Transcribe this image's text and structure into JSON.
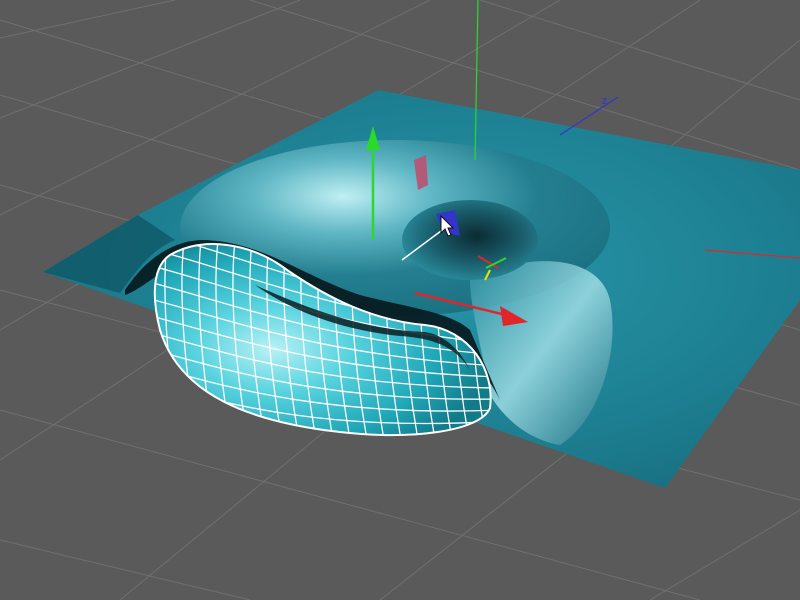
{
  "viewport": {
    "background": "#5a5a5a",
    "grid_color": "#707070",
    "grid_visible": true
  },
  "scene": {
    "plane_color": "#1d8092",
    "plane_shadow_color": "#0d4c59",
    "torus_color": "#28b4c4",
    "torus_highlight": "#a9edf2",
    "wireframe_color": "#ffffff"
  },
  "axes": {
    "x_color": "#e0262a",
    "y_color": "#2bd92b",
    "z_color": "#3335c8"
  },
  "cursor": {
    "icon": "arrow-cursor-icon"
  }
}
